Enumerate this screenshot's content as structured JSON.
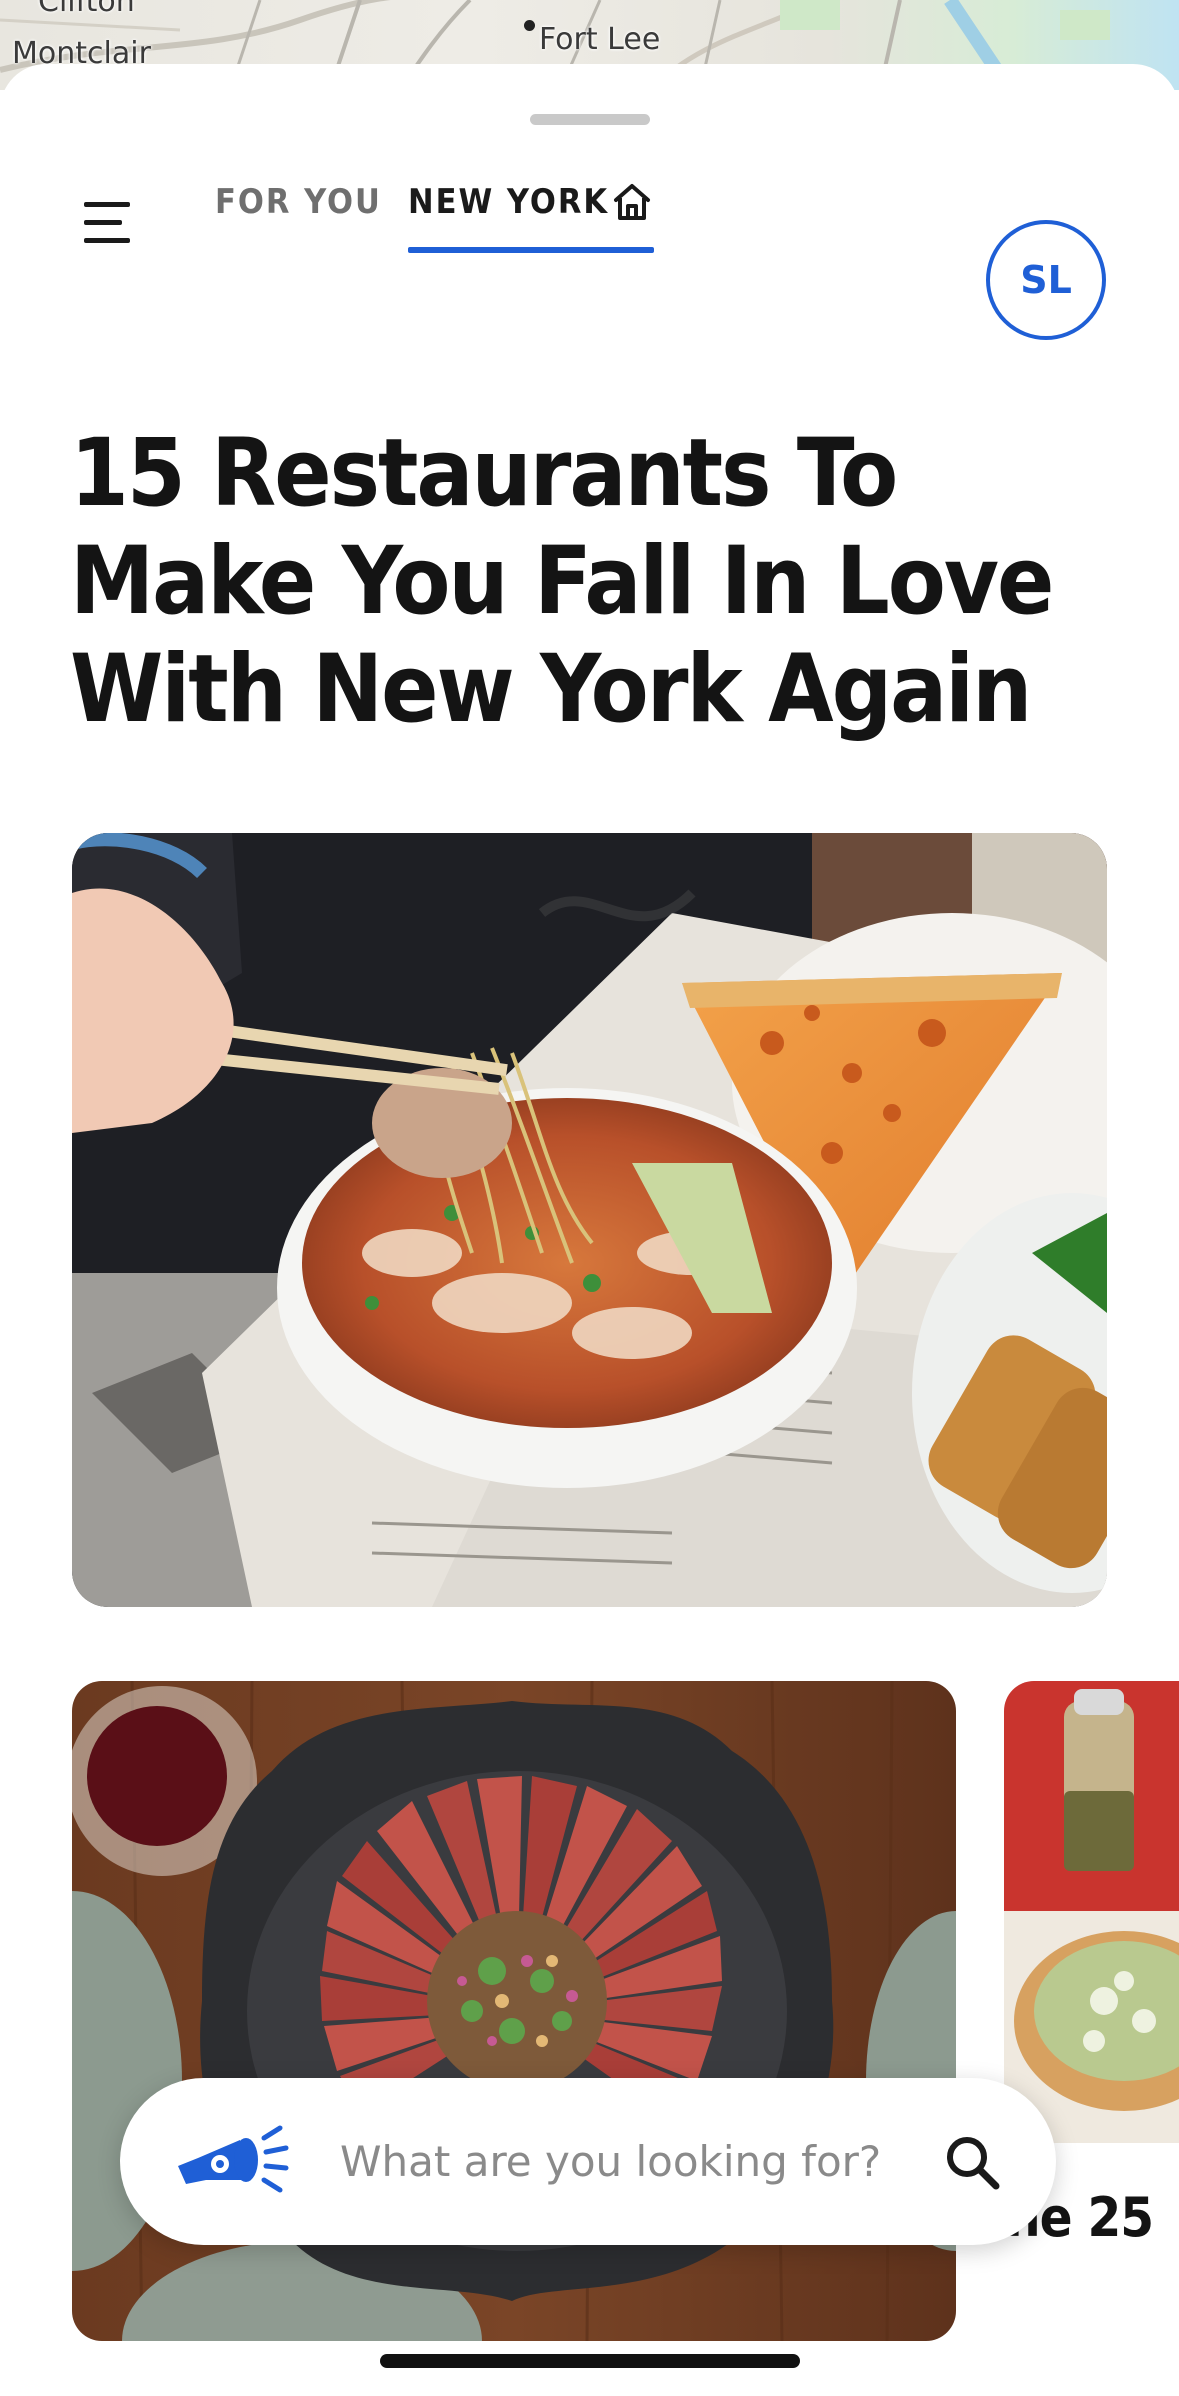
{
  "map": {
    "labels": [
      "Clifton",
      "Montclair",
      "Fort Lee"
    ]
  },
  "nav": {
    "tabs": [
      {
        "label": "FOR YOU",
        "active": false
      },
      {
        "label": "NEW YORK",
        "active": true
      }
    ],
    "avatar_initials": "SL"
  },
  "article": {
    "headline": "15 Restaurants To Make You Fall In Love With New York Again"
  },
  "carousel": {
    "next_card_title_partial": "he 25"
  },
  "search": {
    "placeholder": "What are you looking for?"
  },
  "colors": {
    "accent": "#1f5fd6",
    "text": "#141414",
    "muted": "#6f6f6f"
  }
}
